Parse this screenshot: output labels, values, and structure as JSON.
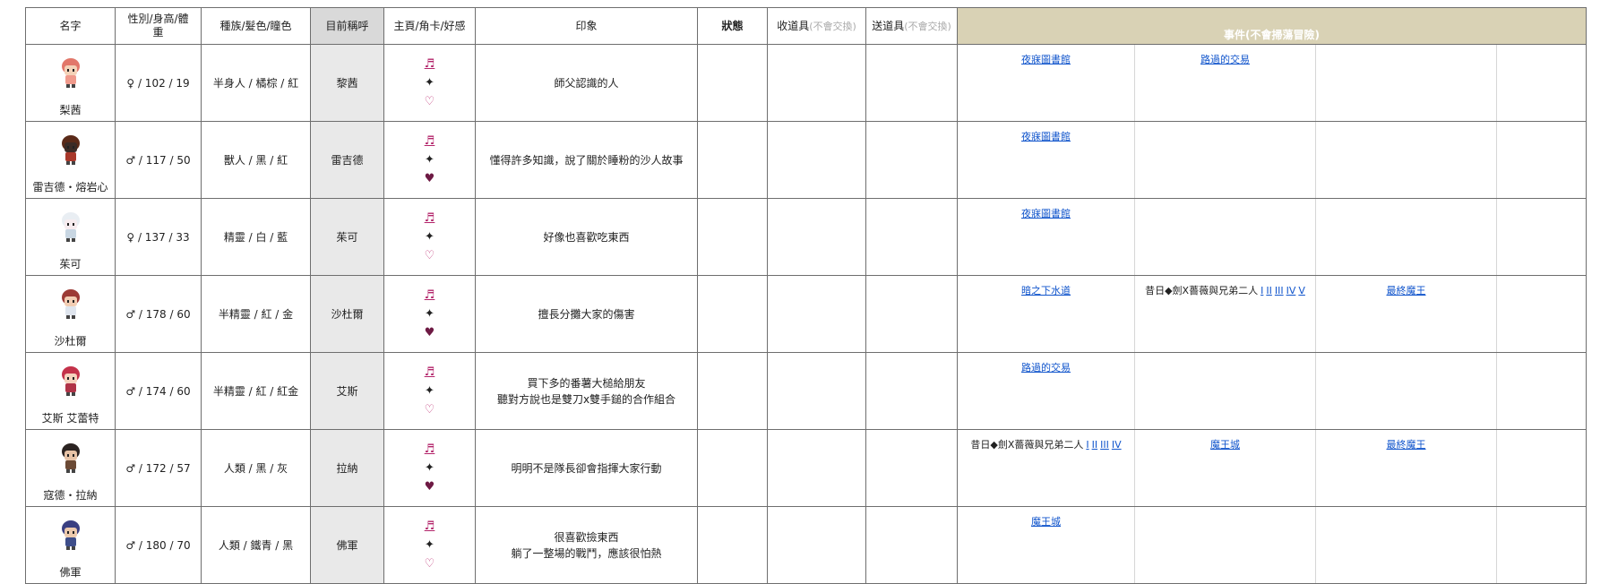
{
  "headers": {
    "name": "名字",
    "stats_line1": "性別/身高/體",
    "stats_line2": "重",
    "race": "種族/髮色/瞳色",
    "current": "目前稱呼",
    "marks": "主頁/角卡/好感",
    "impression": "印象",
    "status": "狀態",
    "receive": "收道具",
    "receive_note": "(不會交換)",
    "send": "送道具",
    "send_note": "(不會交換)",
    "events": "事件(不會掃蕩冒險)"
  },
  "icons": {
    "page": "music-note-icon",
    "card": "sparkle-icon",
    "affection": "heart-icon"
  },
  "colors": {
    "events_header": "#d9d2b5",
    "gray_column": "#d9d9d9",
    "link": "#1155cc",
    "note_icon": "#b3246a"
  },
  "symbols": {
    "note": "♬",
    "star": "✦",
    "heart_empty": "♡",
    "heart_full": "♥"
  },
  "rows": [
    {
      "name": "梨茜",
      "stats": "♀ / 102 / 19",
      "race": "半身人 / 橘棕 / 紅",
      "current": "黎茜",
      "heart": "empty",
      "impression": [
        "師父認識的人"
      ],
      "events": [
        {
          "type": "link",
          "text": "夜寐圖書館"
        },
        {
          "type": "link",
          "text": "路過的交易"
        },
        {
          "type": "empty"
        },
        {
          "type": "empty"
        }
      ]
    },
    {
      "name": "雷吉德・熔岩心",
      "stats": "♂ / 117 / 50",
      "race": "獸人 / 黑 / 紅",
      "current": "雷吉德",
      "heart": "full",
      "impression": [
        "懂得許多知識，說了關於睡粉的沙人故事"
      ],
      "events": [
        {
          "type": "link",
          "text": "夜寐圖書館"
        },
        {
          "type": "empty"
        },
        {
          "type": "empty"
        },
        {
          "type": "empty"
        }
      ]
    },
    {
      "name": "茱可",
      "stats": "♀ / 137 / 33",
      "race": "精靈 / 白 / 藍",
      "current": "茱可",
      "heart": "empty",
      "impression": [
        "好像也喜歡吃東西"
      ],
      "events": [
        {
          "type": "link",
          "text": "夜寐圖書館"
        },
        {
          "type": "empty"
        },
        {
          "type": "empty"
        },
        {
          "type": "empty"
        }
      ]
    },
    {
      "name": "沙杜爾",
      "stats": "♂ / 178 / 60",
      "race": "半精靈 / 紅 / 金",
      "current": "沙杜爾",
      "heart": "full",
      "impression": [
        "擅長分攤大家的傷害"
      ],
      "events": [
        {
          "type": "link",
          "text": "暗之下水道"
        },
        {
          "type": "series",
          "text": "昔日◆劍X薔薇與兄弟二人",
          "parts": [
            "I",
            "II",
            "III",
            "IV",
            "V"
          ]
        },
        {
          "type": "link",
          "text": "最終魔王"
        },
        {
          "type": "empty"
        }
      ]
    },
    {
      "name": "艾斯 艾蕾特",
      "stats": "♂ / 174 / 60",
      "race": "半精靈 / 紅 / 紅金",
      "current": "艾斯",
      "heart": "empty",
      "impression": [
        "買下多的番薯大槌給朋友",
        "聽對方說也是雙刀x雙手鎚的合作組合"
      ],
      "events": [
        {
          "type": "link",
          "text": "路過的交易"
        },
        {
          "type": "empty"
        },
        {
          "type": "empty"
        },
        {
          "type": "empty"
        }
      ]
    },
    {
      "name": "寇德・拉納",
      "stats": "♂ / 172 / 57",
      "race": "人類 / 黑 / 灰",
      "current": "拉納",
      "heart": "full",
      "impression": [
        "明明不是隊長卻會指揮大家行動"
      ],
      "events": [
        {
          "type": "series",
          "text": "昔日◆劍X薔薇與兄弟二人",
          "parts": [
            "I",
            "II",
            "III",
            "IV"
          ]
        },
        {
          "type": "link",
          "text": "魔王城"
        },
        {
          "type": "link",
          "text": "最終魔王"
        },
        {
          "type": "empty"
        }
      ]
    },
    {
      "name": "佛軍",
      "stats": "♂ / 180 / 70",
      "race": "人類 / 鐵青 / 黑",
      "current": "佛軍",
      "heart": "empty",
      "impression": [
        "很喜歡撿東西",
        "躺了一整場的戰鬥，應該很怕熱"
      ],
      "events": [
        {
          "type": "link",
          "text": "魔王城"
        },
        {
          "type": "empty"
        },
        {
          "type": "empty"
        },
        {
          "type": "empty"
        }
      ]
    }
  ]
}
